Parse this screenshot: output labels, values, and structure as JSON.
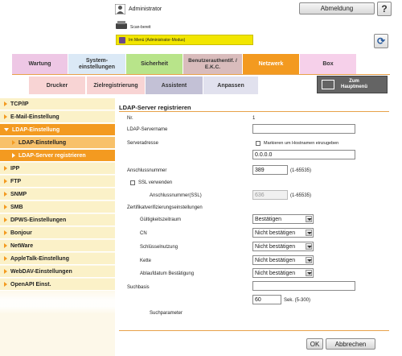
{
  "header": {
    "user": "Administrator",
    "logout_label": "Abmeldung",
    "help_label": "?",
    "status": "Scan-bereit",
    "mode": "Im Menü (Administrator-Modus)"
  },
  "tabs_top": [
    "Wartung",
    "System-\neinstellungen",
    "Sicherheit",
    "Benutzerauthentif. / E.K.C.",
    "Netzwerk",
    "Box"
  ],
  "tabs_second": [
    "Drucker",
    "Zielregistrierung",
    "Assistent",
    "Anpassen"
  ],
  "home_button": "Zum\nHauptmenü",
  "sidebar": {
    "items": [
      {
        "label": "TCP/IP"
      },
      {
        "label": "E-Mail-Einstellung"
      },
      {
        "label": "LDAP-Einstellung"
      },
      {
        "label": "LDAP-Einstellung"
      },
      {
        "label": "LDAP-Server registrieren"
      },
      {
        "label": "IPP"
      },
      {
        "label": "FTP"
      },
      {
        "label": "SNMP"
      },
      {
        "label": "SMB"
      },
      {
        "label": "DPWS-Einstellungen"
      },
      {
        "label": "Bonjour"
      },
      {
        "label": "NetWare"
      },
      {
        "label": "AppleTalk-Einstellung"
      },
      {
        "label": "WebDAV-Einstellungen"
      },
      {
        "label": "OpenAPI Einst."
      }
    ]
  },
  "form": {
    "title": "LDAP-Server registrieren",
    "nr_label": "Nr.",
    "nr_value": "1",
    "server_name_label": "LDAP-Servername",
    "server_name_value": "",
    "server_address_label": "Serveradresse",
    "hostname_check_label": "Markieren um Hostnamen einzugeben",
    "server_address_value": "0.0.0.0",
    "port_label": "Anschlussnummer",
    "port_value": "389",
    "port_range": "(1-65535)",
    "ssl_label": "SSL verwenden",
    "ssl_port_label": "Anschlussnummer(SSL)",
    "ssl_port_value": "636",
    "ssl_port_range": "(1-65535)",
    "cert_section_label": "Zertifikatverifizierungseinstellungen",
    "validity_label": "Gültigkeitszeitraum",
    "validity_value": "Bestätigen",
    "cn_label": "CN",
    "cn_value": "Nicht bestätigen",
    "key_usage_label": "Schlüsselnutzung",
    "key_usage_value": "Nicht bestätigen",
    "chain_label": "Kette",
    "chain_value": "Nicht bestätigen",
    "expiry_label": "Ablaufdatum Bestätigung",
    "expiry_value": "Nicht bestätigen",
    "search_base_label": "Suchbasis",
    "search_base_value": "",
    "timeout_value": "60",
    "timeout_unit": "Sek. (5-300)",
    "search_params_label": "Suchparameter",
    "ok_label": "OK",
    "cancel_label": "Abbrechen"
  },
  "colors": {
    "accent": "#f39a20",
    "mode_bar": "#f2e600",
    "sidebar_bg": "#fbf1c8"
  }
}
